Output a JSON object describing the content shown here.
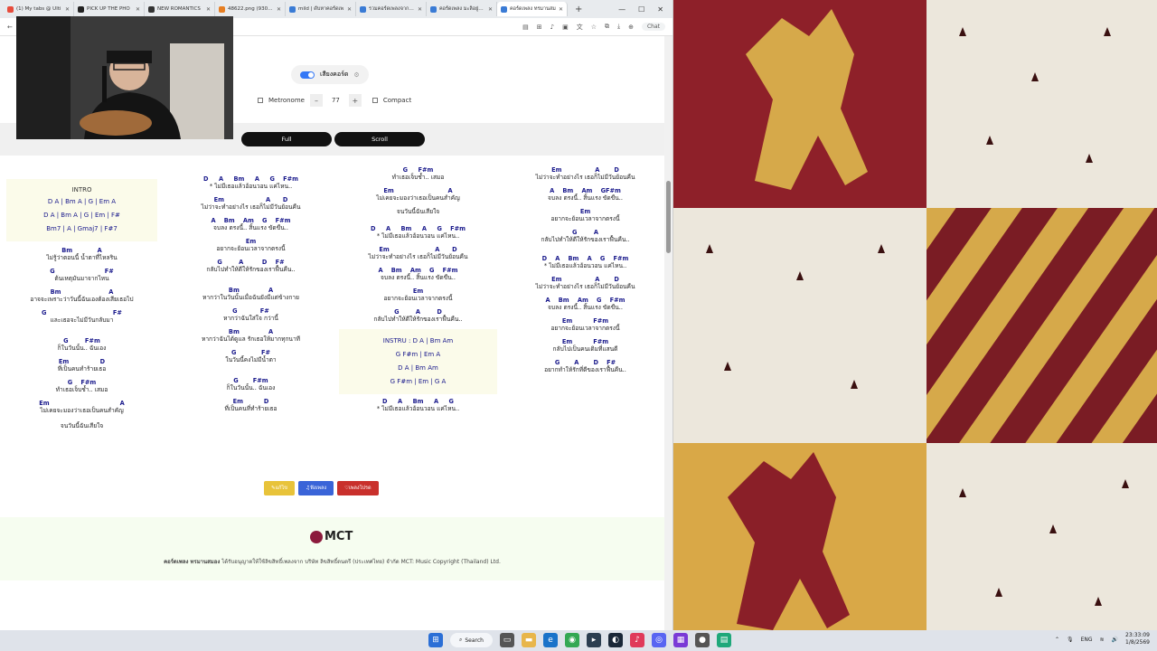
{
  "browser": {
    "tabs": [
      {
        "label": "(1) My tabs @ Ulti",
        "color": "#e74c3c"
      },
      {
        "label": "PICK UP THE PHO",
        "color": "#222"
      },
      {
        "label": "NEW ROMANTICS",
        "color": "#333"
      },
      {
        "label": "48622.png (930×1",
        "color": "#e67e22"
      },
      {
        "label": "mild | ดับหาคอร์ดเพ",
        "color": "#3a7bd5"
      },
      {
        "label": "รวมคอร์ดเพลงจากศิล",
        "color": "#3a7bd5"
      },
      {
        "label": "คอร์ดเพลง มะลิอยู่ไกล",
        "color": "#3a7bd5"
      },
      {
        "label": "คอร์ดเพลง ทรมานสม",
        "color": "#3a7bd5",
        "active": true
      }
    ],
    "new_tab": "+",
    "chat_label": "Chat"
  },
  "controls": {
    "chord_sound_label": "เสียงคอร์ด",
    "metronome_label": "Metronome",
    "minus": "–",
    "bpm": "77",
    "plus": "+",
    "compact_label": "Compact",
    "full_label": "Full",
    "scroll_label": "Scroll"
  },
  "sheet": {
    "intro": {
      "heading": "INTRO",
      "lines": [
        "D A | Bm A | G | Em A",
        "D A | Bm A | G | Em | F#",
        "Bm7 | A | Gmaj7 | F#7"
      ]
    },
    "col1": [
      [
        "Bm            A",
        "ไม่รู้ว่าตอนนี้ น้ำตาที่ไหลริน"
      ],
      [
        "G                        F#",
        "ต้นเหตุมันมาจากไหน"
      ],
      [
        "Bm                       A",
        "อาจจะเพราะว่าวันนี้ฉันเองต้องเสียเธอไป"
      ],
      [
        "G                                F#",
        "และเธอจะไม่มีวันกลับมา"
      ],
      [
        "G        F#m",
        "ก็ในวันนั้น.. ฉันเอง"
      ],
      [
        "Em               D",
        "ที่เป็นคนทำร้ายเธอ"
      ],
      [
        "G    F#m",
        "ทำเธอเจ็บช้ำ.. เสมอ"
      ],
      [
        "Em                                  A",
        "ไม่เคยจะมองว่าเธอเป็นคนสำคัญ"
      ],
      [
        "",
        "จนวันนี้ฉันเสียใจ"
      ]
    ],
    "col2": [
      [
        "D     A     Bm     A     G    F#m",
        "* ไม่มีเธอแล้วอ้อนวอน แค่ไหน.."
      ],
      [
        "Em                    A      D",
        "ไม่ว่าจะทำอย่างไร เธอก็ไม่มีวันย้อนคืน"
      ],
      [
        "A    Bm    Am    G    F#m",
        "จบลง ตรงนี้.. สิ้นแรง ขัดขืน.."
      ],
      [
        "Em",
        "อยากจะย้อนเวลาจากตรงนี้"
      ],
      [
        "G        A         D    F#",
        "กลับไปทำให้ดีให้รักของเราฟื้นคืน.."
      ],
      [
        "Bm              A",
        "หากว่าในวันนั้นเมื่อฉันยังมีแต่ข้างกาย"
      ],
      [
        "G           F#",
        "หากว่าฉันใส่ใจ กว่านี้"
      ],
      [
        "Bm              A",
        "หากว่าฉันได้ดูแล รักเธอให้มากทุกนาที"
      ],
      [
        "G            F#",
        "ในวันนี้คงไม่มีน้ำตา"
      ],
      [
        "G       F#m",
        "ก็ในวันนั้น.. ฉันเอง"
      ],
      [
        "Em          D",
        "ที่เป็นคนที่ทำร้ายเธอ"
      ]
    ],
    "col3_top": [
      [
        "G     F#m",
        "ทำเธอเจ็บช้ำ.. เสมอ"
      ],
      [
        "Em                          A",
        "ไม่เคยจะมองว่าเธอเป็นคนสำคัญ"
      ],
      [
        "",
        "จนวันนี้ฉันเสียใจ"
      ],
      [
        "D     A     Bm     A     G    F#m",
        "* ไม่มีเธอแล้วอ้อนวอน แค่ไหน.."
      ],
      [
        "Em                      A      D",
        "ไม่ว่าจะทำอย่างไร เธอก็ไม่มีวันย้อนคืน"
      ],
      [
        "A    Bm    Am    G    F#m",
        "จบลง ตรงนี้.. สิ้นแรง ขัดขืน.."
      ],
      [
        "Em",
        "อยากจะย้อนเวลาจากตรงนี้"
      ],
      [
        "G        A        D",
        "กลับไปทำให้ดีให้รักของเราฟื้นคืน.."
      ]
    ],
    "instru": {
      "lines": [
        "INSTRU : D A | Bm Am",
        "G F#m | Em A",
        "D A | Bm Am",
        "G F#m | Em | G A"
      ]
    },
    "col3_bottom": [
      [
        "D     A     Bm     A     G",
        "* ไม่มีเธอแล้วอ้อนวอน แค่ไหน.."
      ]
    ],
    "col4": [
      [
        "Em                A       D",
        "ไม่ว่าจะทำอย่างไร เธอก็ไม่มีวันย้อนคืน"
      ],
      [
        "A    Bm    Am    GF#m",
        "จบลง ตรงนี้.. สิ้นแรง ขัดขืน.."
      ],
      [
        "Em",
        "อยากจะย้อนเวลาจากตรงนี้"
      ],
      [
        "G        A",
        "กลับไปทำให้ดีให้รักของเราฟื้นคืน.."
      ],
      [
        "D    A    Bm    A    G    F#m",
        "* ไม่มีเธอแล้วอ้อนวอน แค่ไหน.."
      ],
      [
        "Em                A       D",
        "ไม่ว่าจะทำอย่างไร เธอก็ไม่มีวันย้อนคืน"
      ],
      [
        "A    Bm    Am    G    F#m",
        "จบลง ตรงนี้.. สิ้นแรง ขัดขืน.."
      ],
      [
        "Em          F#m",
        "อยากจะย้อนเวลาจากตรงนี้"
      ],
      [
        "Em          F#m",
        "กลับไปเป็นคนเดิมที่แสนดี"
      ],
      [
        "G       A       D    F#",
        "อยากทำให้รักที่ดีของเราฟื้นคืน.."
      ]
    ]
  },
  "actions": {
    "edit_label": "แก้ไข",
    "edit_color": "#e8c33a",
    "play_label": "ฟังเพลง",
    "play_color": "#3a64d8",
    "fav_label": "เพลงโปรด",
    "fav_color": "#c9302c"
  },
  "footer": {
    "logo_text": "MCT",
    "copyright_bold": "คอร์ดเพลง ทรมานสมอง",
    "copyright_rest": " ได้รับอนุญาตให้ใช้ลิขสิทธิ์เพลงจาก บริษัท ลิขสิทธิ์ดนตรี (ประเทศไทย) จำกัด MCT: Music Copyright (Thailand) Ltd."
  },
  "taskbar": {
    "search_label": "Search",
    "lang": "ENG",
    "time": "23:33:09",
    "date": "1/8/2569"
  }
}
